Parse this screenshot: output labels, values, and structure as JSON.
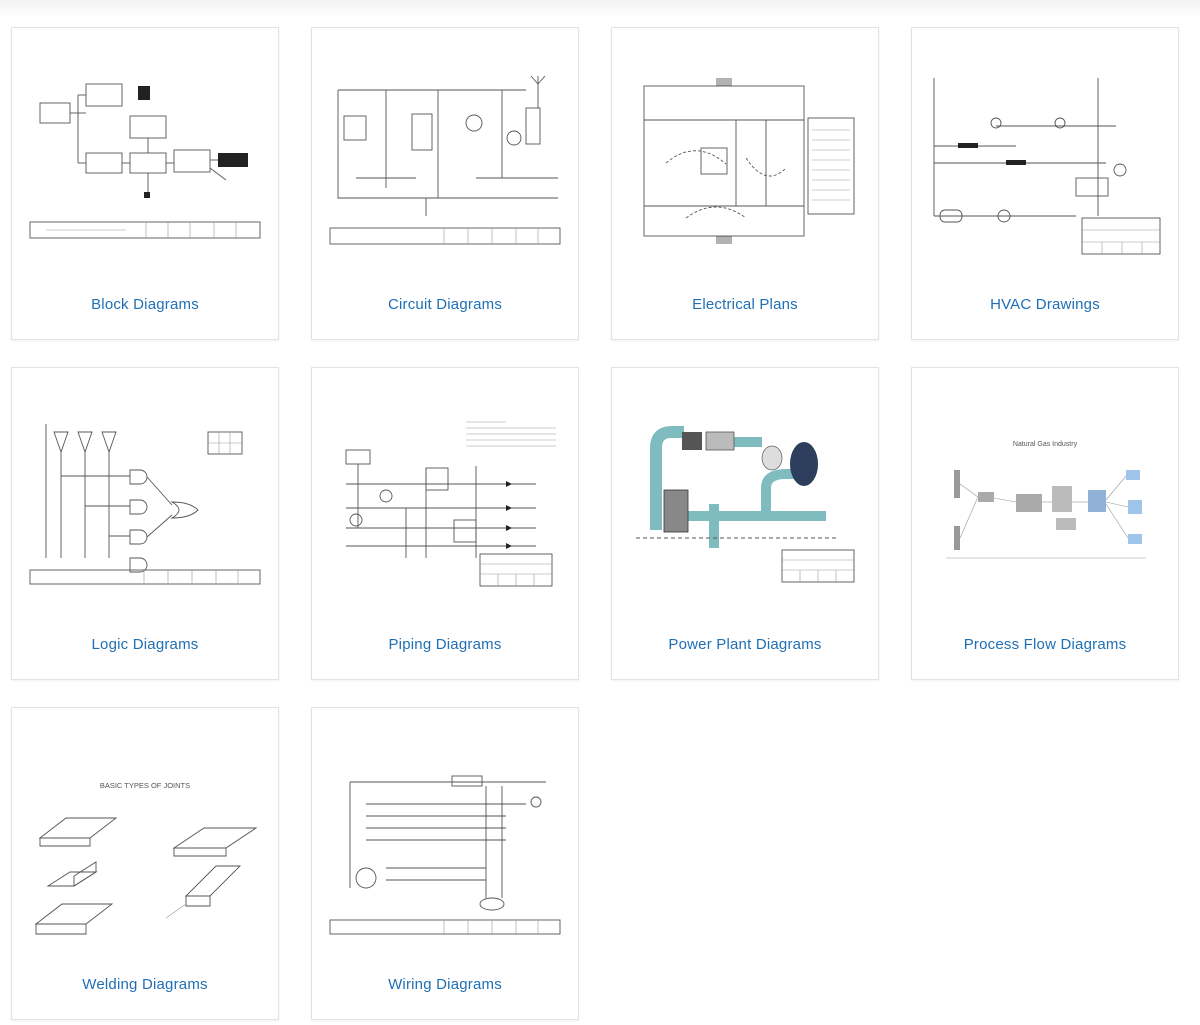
{
  "cards": [
    {
      "label": "Block Diagrams",
      "thumbnail": "block-diagram-thumbnail"
    },
    {
      "label": "Circuit Diagrams",
      "thumbnail": "circuit-diagram-thumbnail"
    },
    {
      "label": "Electrical Plans",
      "thumbnail": "electrical-plan-thumbnail"
    },
    {
      "label": "HVAC Drawings",
      "thumbnail": "hvac-drawing-thumbnail"
    },
    {
      "label": "Logic Diagrams",
      "thumbnail": "logic-diagram-thumbnail"
    },
    {
      "label": "Piping Diagrams",
      "thumbnail": "piping-diagram-thumbnail"
    },
    {
      "label": "Power Plant Diagrams",
      "thumbnail": "power-plant-diagram-thumbnail"
    },
    {
      "label": "Process Flow Diagrams",
      "thumbnail": "process-flow-diagram-thumbnail"
    },
    {
      "label": "Welding Diagrams",
      "thumbnail": "welding-diagram-thumbnail"
    },
    {
      "label": "Wiring Diagrams",
      "thumbnail": "wiring-diagram-thumbnail"
    }
  ],
  "thumbnail_text": {
    "process_flow_title": "Natural Gas Industry",
    "welding_title": "BASIC TYPES OF JOINTS"
  },
  "colors": {
    "label": "#1f6fb5",
    "card_border": "#e1e3e6",
    "power_plant_pipe": "#7fbcc0"
  }
}
